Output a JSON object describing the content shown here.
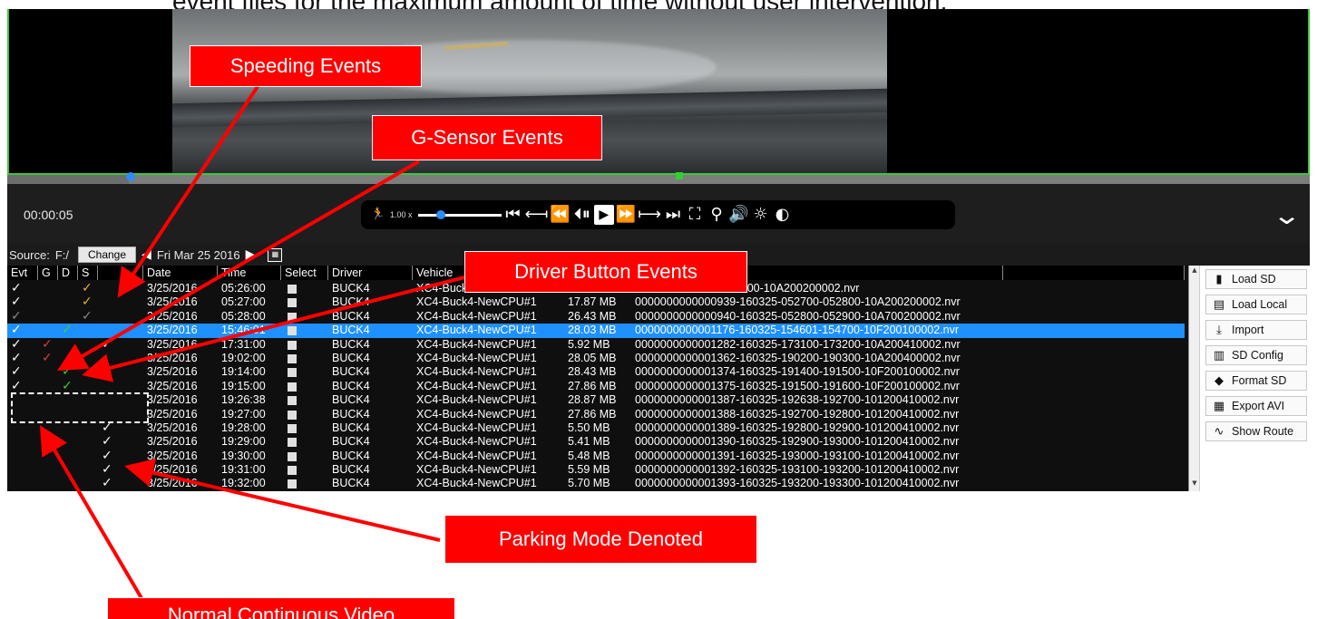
{
  "doc_text": "event files for the maximum amount of time without user intervention.",
  "player": {
    "time": "00:00:05",
    "speed": "1.00 x"
  },
  "toolbar": {
    "source_label": "Source:",
    "source_value": "F:/",
    "change_label": "Change",
    "date": "Fri Mar 25 2016"
  },
  "table": {
    "headers": [
      "Evt",
      "G",
      "D",
      "S",
      "",
      "Date",
      "Time",
      "Select",
      "Driver",
      "Vehicle",
      "",
      "",
      ""
    ],
    "rows": [
      {
        "evt": "white",
        "g": "",
        "d": "",
        "s": "yellow",
        "x": "",
        "date": "3/25/2016",
        "time": "05:26:00",
        "driver": "BUCK4",
        "vehicle": "XC4-Buck4-NewCPU#1",
        "size": "",
        "file": "-160325-052600-052700-10A200200002.nvr"
      },
      {
        "evt": "white",
        "g": "",
        "d": "",
        "s": "yellow",
        "x": "",
        "date": "3/25/2016",
        "time": "05:27:00",
        "driver": "BUCK4",
        "vehicle": "XC4-Buck4-NewCPU#1",
        "size": "17.87 MB",
        "file": "0000000000000939-160325-052700-052800-10A200200002.nvr"
      },
      {
        "evt": "gray",
        "g": "",
        "d": "",
        "s": "gray",
        "x": "",
        "date": "3/25/2016",
        "time": "05:28:00",
        "driver": "BUCK4",
        "vehicle": "XC4-Buck4-NewCPU#1",
        "size": "26.43 MB",
        "file": "0000000000000940-160325-052800-052900-10A700200002.nvr"
      },
      {
        "evt": "white",
        "g": "",
        "d": "green",
        "s": "",
        "x": "",
        "date": "3/25/2016",
        "time": "15:46:01",
        "driver": "BUCK4",
        "vehicle": "XC4-Buck4-NewCPU#1",
        "size": "28.03 MB",
        "file": "0000000000001176-160325-154601-154700-10F200100002.nvr",
        "selected": true
      },
      {
        "evt": "white",
        "g": "red",
        "d": "",
        "s": "",
        "x": "white",
        "date": "3/25/2016",
        "time": "17:31:00",
        "driver": "BUCK4",
        "vehicle": "XC4-Buck4-NewCPU#1",
        "size": "5.92 MB",
        "file": "0000000000001282-160325-173100-173200-10A200410002.nvr"
      },
      {
        "evt": "white",
        "g": "red",
        "d": "",
        "s": "",
        "x": "",
        "date": "3/25/2016",
        "time": "19:02:00",
        "driver": "BUCK4",
        "vehicle": "XC4-Buck4-NewCPU#1",
        "size": "28.05 MB",
        "file": "0000000000001362-160325-190200-190300-10A200400002.nvr"
      },
      {
        "evt": "white",
        "g": "",
        "d": "green",
        "s": "",
        "x": "",
        "date": "3/25/2016",
        "time": "19:14:00",
        "driver": "BUCK4",
        "vehicle": "XC4-Buck4-NewCPU#1",
        "size": "28.43 MB",
        "file": "0000000000001374-160325-191400-191500-10F200100002.nvr"
      },
      {
        "evt": "white",
        "g": "",
        "d": "green",
        "s": "",
        "x": "",
        "date": "3/25/2016",
        "time": "19:15:00",
        "driver": "BUCK4",
        "vehicle": "XC4-Buck4-NewCPU#1",
        "size": "27.86 MB",
        "file": "0000000000001375-160325-191500-191600-10F200100002.nvr"
      },
      {
        "evt": "",
        "g": "",
        "d": "",
        "s": "",
        "x": "",
        "date": "3/25/2016",
        "time": "19:26:38",
        "driver": "BUCK4",
        "vehicle": "XC4-Buck4-NewCPU#1",
        "size": "28.87 MB",
        "file": "0000000000001387-160325-192638-192700-101200410002.nvr"
      },
      {
        "evt": "",
        "g": "",
        "d": "",
        "s": "",
        "x": "",
        "date": "3/25/2016",
        "time": "19:27:00",
        "driver": "BUCK4",
        "vehicle": "XC4-Buck4-NewCPU#1",
        "size": "27.86 MB",
        "file": "0000000000001388-160325-192700-192800-101200410002.nvr"
      },
      {
        "evt": "",
        "g": "",
        "d": "",
        "s": "",
        "x": "white",
        "date": "3/25/2016",
        "time": "19:28:00",
        "driver": "BUCK4",
        "vehicle": "XC4-Buck4-NewCPU#1",
        "size": "5.50 MB",
        "file": "0000000000001389-160325-192800-192900-101200410002.nvr"
      },
      {
        "evt": "",
        "g": "",
        "d": "",
        "s": "",
        "x": "white",
        "date": "3/25/2016",
        "time": "19:29:00",
        "driver": "BUCK4",
        "vehicle": "XC4-Buck4-NewCPU#1",
        "size": "5.41 MB",
        "file": "0000000000001390-160325-192900-193000-101200410002.nvr"
      },
      {
        "evt": "",
        "g": "",
        "d": "",
        "s": "",
        "x": "white",
        "date": "3/25/2016",
        "time": "19:30:00",
        "driver": "BUCK4",
        "vehicle": "XC4-Buck4-NewCPU#1",
        "size": "5.48 MB",
        "file": "0000000000001391-160325-193000-193100-101200410002.nvr"
      },
      {
        "evt": "",
        "g": "",
        "d": "",
        "s": "",
        "x": "white",
        "date": "3/25/2016",
        "time": "19:31:00",
        "driver": "BUCK4",
        "vehicle": "XC4-Buck4-NewCPU#1",
        "size": "5.59 MB",
        "file": "0000000000001392-160325-193100-193200-101200410002.nvr"
      },
      {
        "evt": "",
        "g": "",
        "d": "",
        "s": "",
        "x": "white",
        "date": "3/25/2016",
        "time": "19:32:00",
        "driver": "BUCK4",
        "vehicle": "XC4-Buck4-NewCPU#1",
        "size": "5.70 MB",
        "file": "0000000000001393-160325-193200-193300-101200410002.nvr"
      }
    ]
  },
  "side_buttons": [
    {
      "label": "Load SD",
      "icon": "sd-card-icon"
    },
    {
      "label": "Load Local",
      "icon": "drive-icon"
    },
    {
      "label": "Import",
      "icon": "import-icon"
    },
    {
      "label": "SD Config",
      "icon": "config-icon"
    },
    {
      "label": "Format SD",
      "icon": "eraser-icon"
    },
    {
      "label": "Export AVI",
      "icon": "film-icon"
    },
    {
      "label": "Show Route",
      "icon": "route-icon"
    }
  ],
  "callouts": {
    "speeding": "Speeding Events",
    "gsensor": "G-Sensor Events",
    "driver": "Driver Button Events",
    "parking": "Parking Mode Denoted",
    "normal": "Normal Continuous Video"
  },
  "colors": {
    "callout": "#ff0000",
    "selected_row": "#1e90ff",
    "video_border": "#3ec63e",
    "check_red": "#e03a3a",
    "check_green": "#35d235",
    "check_yellow": "#e6b224"
  }
}
